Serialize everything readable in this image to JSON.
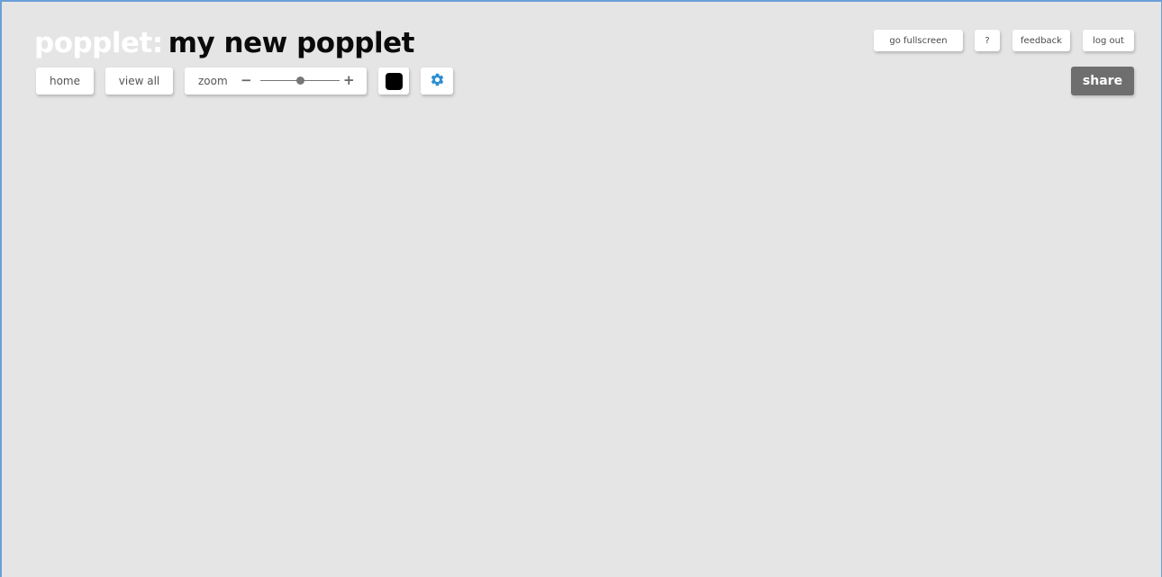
{
  "header": {
    "brand": "popplet",
    "separator": ":",
    "document_title": "my new popplet"
  },
  "toolbar": {
    "home_label": "home",
    "view_all_label": "view all",
    "zoom": {
      "label": "zoom",
      "minus": "−",
      "plus": "+",
      "level": 0.5
    },
    "color_swatch": "#000000",
    "settings_icon": "gear-icon",
    "settings_color": "#2a8fd0"
  },
  "top_right": {
    "fullscreen_label": "go fullscreen",
    "help_label": "?",
    "feedback_label": "feedback",
    "logout_label": "log out",
    "share_label": "share"
  },
  "colors": {
    "background": "#e5e5e5",
    "share_button": "#6e6e6e"
  }
}
